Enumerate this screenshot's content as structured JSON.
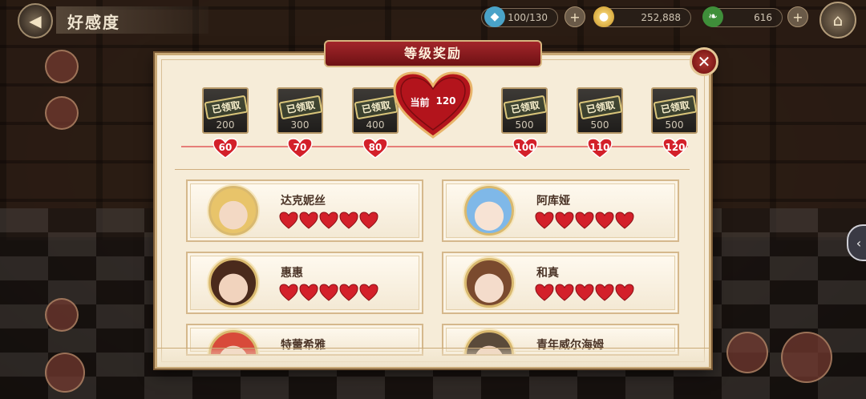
{
  "hud": {
    "title": "好感度",
    "stamina": "100/130",
    "gold": "252,888",
    "gems": "616",
    "back_icon": "back-arrow-icon",
    "home_icon": "home-icon"
  },
  "panel": {
    "title": "等级奖励",
    "close_icon": "close-x-icon",
    "current_label": "当前",
    "current_value": "120"
  },
  "rewards": [
    {
      "status": "已领取",
      "amount": "200"
    },
    {
      "status": "已领取",
      "amount": "300"
    },
    {
      "status": "已领取",
      "amount": "400"
    },
    {
      "status": "已领取",
      "amount": "500"
    },
    {
      "status": "已领取",
      "amount": "500"
    },
    {
      "status": "已领取",
      "amount": "500"
    }
  ],
  "levels": [
    "60",
    "70",
    "80",
    "100",
    "110",
    "120"
  ],
  "characters": [
    {
      "name": "达克妮丝",
      "hearts": 5,
      "avatar_color": "#e8c46a"
    },
    {
      "name": "阿库娅",
      "hearts": 5,
      "avatar_color": "#7fb8e8"
    },
    {
      "name": "惠惠",
      "hearts": 5,
      "avatar_color": "#6a3a2a"
    },
    {
      "name": "和真",
      "hearts": 5,
      "avatar_color": "#7a4a2e"
    },
    {
      "name": "特蕾希雅",
      "hearts": 0,
      "avatar_color": "#d84a3a"
    },
    {
      "name": "青年威尔海姆",
      "hearts": 0,
      "avatar_color": "#5a4a3a"
    }
  ],
  "colors": {
    "heart_red": "#d3202a",
    "header_red": "#8c1b1f",
    "panel_bg": "#f6ecd8",
    "gold_border": "#c9a977"
  }
}
